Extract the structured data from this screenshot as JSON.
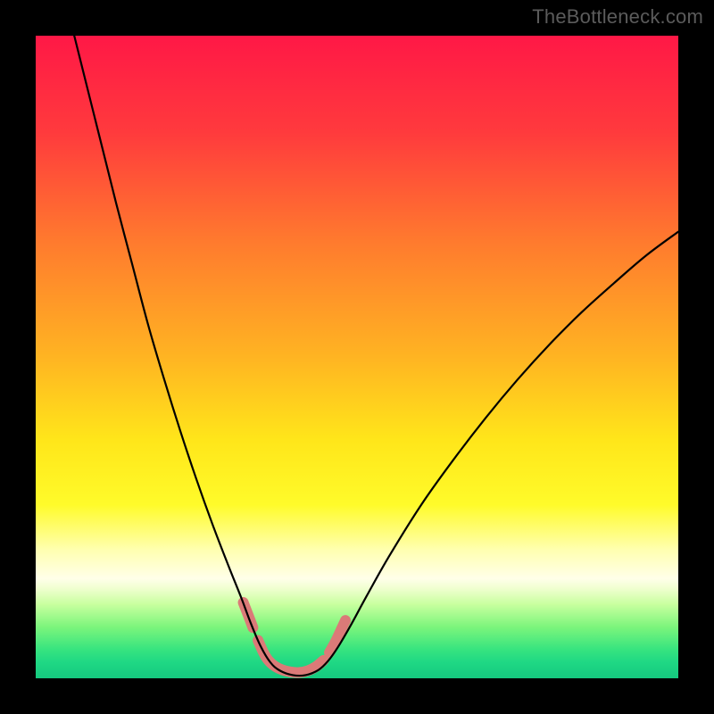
{
  "watermark": "TheBottleneck.com",
  "chart_data": {
    "type": "line",
    "title": "",
    "xlabel": "",
    "ylabel": "",
    "xlim": [
      0,
      100
    ],
    "ylim": [
      0,
      100
    ],
    "grid": false,
    "legend": false,
    "annotations": [],
    "gradient_stops": [
      {
        "offset": 0.0,
        "color": "#ff1846"
      },
      {
        "offset": 0.15,
        "color": "#ff3a3d"
      },
      {
        "offset": 0.32,
        "color": "#ff7a2e"
      },
      {
        "offset": 0.5,
        "color": "#ffb422"
      },
      {
        "offset": 0.63,
        "color": "#ffe61a"
      },
      {
        "offset": 0.73,
        "color": "#fffb2a"
      },
      {
        "offset": 0.8,
        "color": "#ffffb0"
      },
      {
        "offset": 0.845,
        "color": "#ffffe9"
      },
      {
        "offset": 0.86,
        "color": "#f0ffd0"
      },
      {
        "offset": 0.885,
        "color": "#c8ff9f"
      },
      {
        "offset": 0.92,
        "color": "#7cf57c"
      },
      {
        "offset": 0.955,
        "color": "#37e47f"
      },
      {
        "offset": 0.975,
        "color": "#1fd884"
      },
      {
        "offset": 1.0,
        "color": "#15c97f"
      }
    ],
    "series": [
      {
        "name": "bottleneck-curve",
        "color": "#000000",
        "width": 2.2,
        "points": [
          {
            "x": 6.0,
            "y": 100.0
          },
          {
            "x": 8.0,
            "y": 92.0
          },
          {
            "x": 10.0,
            "y": 84.0
          },
          {
            "x": 12.5,
            "y": 74.0
          },
          {
            "x": 15.0,
            "y": 64.5
          },
          {
            "x": 17.5,
            "y": 55.0
          },
          {
            "x": 20.0,
            "y": 46.5
          },
          {
            "x": 22.5,
            "y": 38.5
          },
          {
            "x": 25.0,
            "y": 31.0
          },
          {
            "x": 27.5,
            "y": 24.0
          },
          {
            "x": 30.0,
            "y": 17.5
          },
          {
            "x": 32.0,
            "y": 12.5
          },
          {
            "x": 33.5,
            "y": 8.5
          },
          {
            "x": 35.0,
            "y": 5.0
          },
          {
            "x": 36.5,
            "y": 2.5
          },
          {
            "x": 38.0,
            "y": 1.2
          },
          {
            "x": 40.0,
            "y": 0.5
          },
          {
            "x": 42.0,
            "y": 0.5
          },
          {
            "x": 44.0,
            "y": 1.3
          },
          {
            "x": 45.5,
            "y": 2.7
          },
          {
            "x": 47.0,
            "y": 4.8
          },
          {
            "x": 49.0,
            "y": 8.2
          },
          {
            "x": 51.5,
            "y": 12.8
          },
          {
            "x": 55.0,
            "y": 19.0
          },
          {
            "x": 60.0,
            "y": 27.0
          },
          {
            "x": 65.0,
            "y": 34.0
          },
          {
            "x": 70.0,
            "y": 40.5
          },
          {
            "x": 75.0,
            "y": 46.5
          },
          {
            "x": 80.0,
            "y": 52.0
          },
          {
            "x": 85.0,
            "y": 57.0
          },
          {
            "x": 90.0,
            "y": 61.5
          },
          {
            "x": 95.0,
            "y": 65.8
          },
          {
            "x": 100.0,
            "y": 69.5
          }
        ]
      },
      {
        "name": "marker-strip",
        "color": "#db7a78",
        "width": 12,
        "linecap": "round",
        "points": [
          {
            "x": 32.3,
            "y": 11.8
          },
          {
            "x": 33.0,
            "y": 10.0
          },
          {
            "x": 33.8,
            "y": 7.9
          },
          {
            "x": 34.6,
            "y": 5.9
          },
          {
            "x": 35.4,
            "y": 4.1
          },
          {
            "x": 36.2,
            "y": 2.8
          },
          {
            "x": 37.2,
            "y": 1.9
          },
          {
            "x": 38.4,
            "y": 1.3
          },
          {
            "x": 39.6,
            "y": 1.0
          },
          {
            "x": 41.0,
            "y": 0.9
          },
          {
            "x": 42.4,
            "y": 1.2
          },
          {
            "x": 43.6,
            "y": 1.8
          },
          {
            "x": 44.8,
            "y": 2.8
          },
          {
            "x": 45.7,
            "y": 4.0
          },
          {
            "x": 46.6,
            "y": 5.6
          },
          {
            "x": 47.5,
            "y": 7.5
          },
          {
            "x": 48.2,
            "y": 9.0
          }
        ],
        "gaps_after_index": [
          2,
          12
        ]
      }
    ]
  }
}
